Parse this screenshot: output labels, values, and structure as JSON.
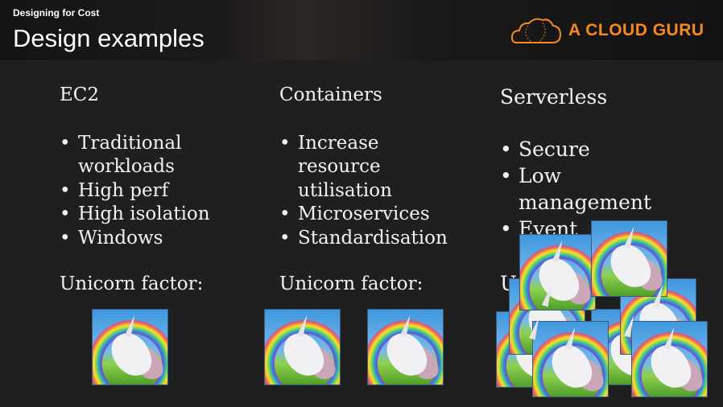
{
  "header": {
    "subtitle": "Designing for Cost",
    "title": "Design examples",
    "logo_text": "A CLOUD GURU",
    "logo_color": "#f58a1f"
  },
  "columns": [
    {
      "heading": "EC2",
      "bullets": [
        "Traditional workloads",
        "High perf",
        "High isolation",
        "Windows"
      ],
      "unicorn_label": "Unicorn factor:",
      "unicorn_count": 1
    },
    {
      "heading": "Containers",
      "bullets": [
        "Increase resource utilisation",
        "Microservices",
        "Standardisation"
      ],
      "unicorn_label": "Unicorn factor:",
      "unicorn_count": 2
    },
    {
      "heading": "Serverless",
      "bullets": [
        "Secure",
        "Low management",
        "Event"
      ],
      "unicorn_label": "U",
      "unicorn_count": 8
    }
  ]
}
